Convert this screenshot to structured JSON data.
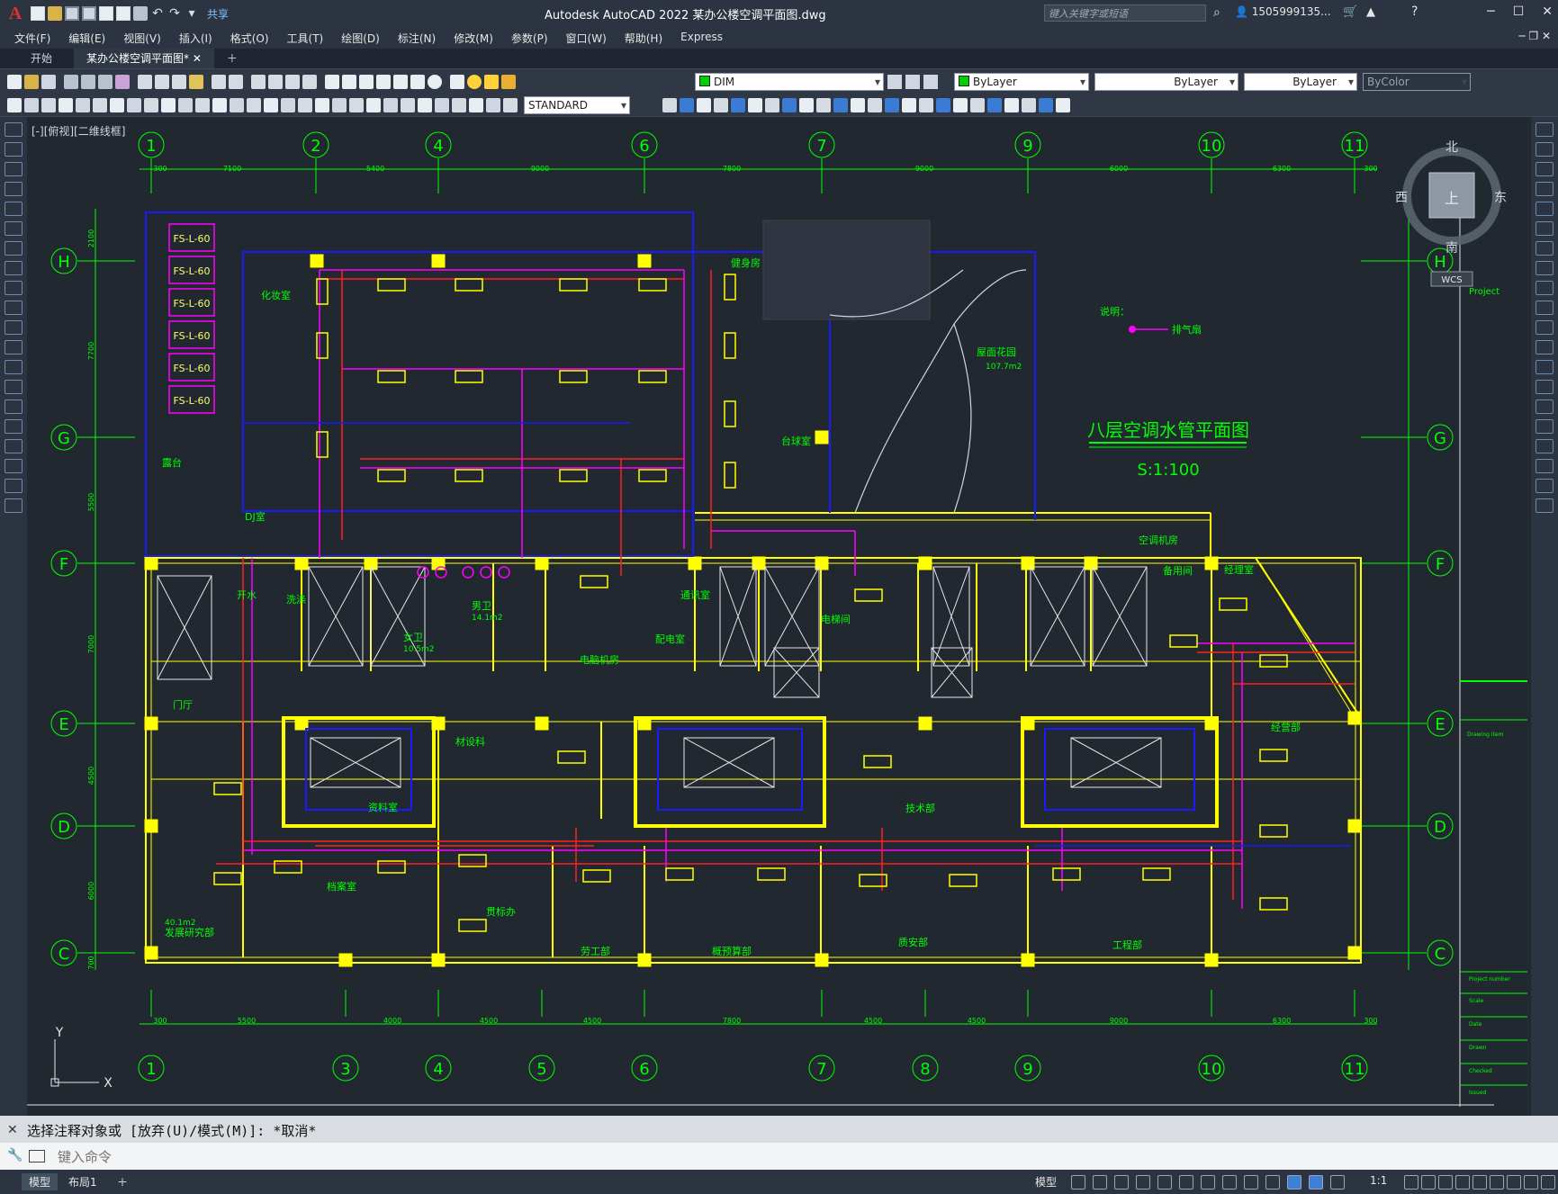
{
  "title_bar": {
    "app_title": "Autodesk AutoCAD 2022    某办公楼空调平面图.dwg",
    "share_label": "共享",
    "search_placeholder": "键入关键字或短语",
    "user": "1505999135...",
    "logo": "A"
  },
  "menu": [
    "文件(F)",
    "编辑(E)",
    "视图(V)",
    "插入(I)",
    "格式(O)",
    "工具(T)",
    "绘图(D)",
    "标注(N)",
    "修改(M)",
    "参数(P)",
    "窗口(W)",
    "帮助(H)",
    "Express"
  ],
  "tabs": [
    {
      "label": "开始",
      "active": false
    },
    {
      "label": "某办公楼空调平面图*",
      "active": true
    }
  ],
  "toolbar": {
    "layer": "DIM",
    "color": "ByLayer",
    "linetype": "ByLayer",
    "lineweight": "ByLayer",
    "plotstyle": "ByColor",
    "textstyle": "STANDARD"
  },
  "view_label": "[-][俯视][二维线框]",
  "viewcube": {
    "north": "北",
    "south": "南",
    "east": "东",
    "west": "西",
    "top": "上",
    "wcs": "WCS"
  },
  "drawing": {
    "title": "八层空调水管平面图",
    "scale": "S:1:100",
    "legend_title": "说明：",
    "legend_item": "排气扇",
    "grid_top": [
      "1",
      "2",
      "4",
      "6",
      "7",
      "9",
      "10",
      "11"
    ],
    "grid_bottom": [
      "1",
      "3",
      "4",
      "5",
      "6",
      "7",
      "8",
      "9",
      "10",
      "11"
    ],
    "grid_rows": [
      "H",
      "G",
      "F",
      "E",
      "D",
      "C"
    ],
    "dims_top": [
      "300",
      "7100",
      "5400",
      "9000",
      "7800",
      "9000",
      "6000",
      "6300",
      "300"
    ],
    "dims_bottom": [
      "300",
      "5500",
      "4000",
      "4500",
      "4500",
      "7800",
      "4500",
      "4500",
      "9000",
      "6300",
      "300"
    ],
    "dims_left": [
      "2100",
      "7700",
      "5500",
      "7000",
      "4500",
      "6000",
      "700"
    ],
    "fan_coil_units": [
      "FS-L-60",
      "FS-L-60",
      "FS-L-60",
      "FS-L-60",
      "FS-L-60",
      "FS-L-60"
    ],
    "rooms": [
      {
        "name": "化妆室"
      },
      {
        "name": "露台"
      },
      {
        "name": "DJ室"
      },
      {
        "name": "健身房"
      },
      {
        "name": "台球室"
      },
      {
        "name": "屋面花园",
        "area": "107.7m2"
      },
      {
        "name": "空调机房"
      },
      {
        "name": "备用间"
      },
      {
        "name": "经理室"
      },
      {
        "name": "开水"
      },
      {
        "name": "洗涤"
      },
      {
        "name": "女卫",
        "area": "10.5m2"
      },
      {
        "name": "男卫",
        "area": "14.1m2"
      },
      {
        "name": "电脑机房"
      },
      {
        "name": "通讯室"
      },
      {
        "name": "配电室"
      },
      {
        "name": "电梯间"
      },
      {
        "name": "门厅"
      },
      {
        "name": "材设科"
      },
      {
        "name": "资料室"
      },
      {
        "name": "经营部"
      },
      {
        "name": "技术部"
      },
      {
        "name": "档案室"
      },
      {
        "name": "贯标办"
      },
      {
        "name": "劳工部"
      },
      {
        "name": "概预算部"
      },
      {
        "name": "质安部"
      },
      {
        "name": "工程部"
      },
      {
        "name": "发展研究部",
        "area": "40.1m2"
      }
    ],
    "title_block": [
      "Project",
      "Drawing item",
      "Project number",
      "Scale",
      "Date",
      "Drawn",
      "Checked",
      "Issued"
    ],
    "ucs": {
      "x": "X",
      "y": "Y"
    }
  },
  "command": {
    "history": "选择注释对象或 [放弃(U)/模式(M)]: *取消*",
    "placeholder": "键入命令"
  },
  "status": {
    "layout_tabs": [
      "模型",
      "布局1"
    ],
    "model_label": "模型",
    "scale": "1:1"
  },
  "colors": {
    "wall": "#ffff00",
    "pipe_blue": "#1a1aff",
    "pipe_magenta": "#ff00ff",
    "pipe_red": "#ff2020",
    "text": "#00ff00",
    "grid": "#00ff00"
  }
}
